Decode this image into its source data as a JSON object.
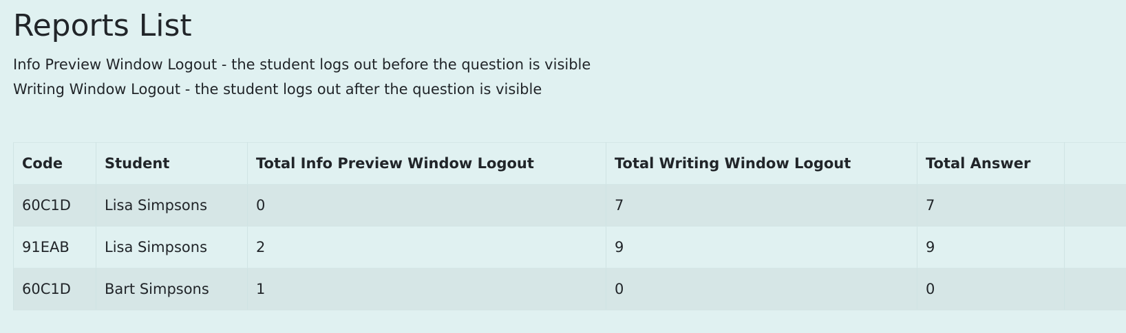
{
  "page": {
    "title": "Reports List",
    "descriptions": [
      "Info Preview Window Logout - the student logs out before the question is visible",
      "Writing Window Logout - the student logs out after the question is visible"
    ]
  },
  "table": {
    "headers": [
      "Code",
      "Student",
      "Total Info Preview Window Logout",
      "Total Writing Window Logout",
      "Total Answer",
      ""
    ],
    "rows": [
      [
        "60C1D",
        "Lisa Simpsons",
        "0",
        "7",
        "7",
        ""
      ],
      [
        "91EAB",
        "Lisa Simpsons",
        "2",
        "9",
        "9",
        ""
      ],
      [
        "60C1D",
        "Bart Simpsons",
        "1",
        "0",
        "0",
        ""
      ]
    ]
  }
}
